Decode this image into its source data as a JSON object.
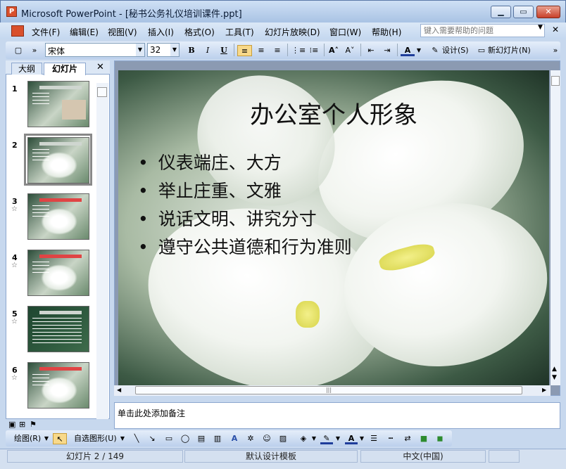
{
  "window": {
    "title": "Microsoft PowerPoint - [秘书公务礼仪培训课件.ppt]"
  },
  "menu": {
    "items": [
      "文件(F)",
      "编辑(E)",
      "视图(V)",
      "插入(I)",
      "格式(O)",
      "工具(T)",
      "幻灯片放映(D)",
      "窗口(W)",
      "帮助(H)"
    ],
    "help_placeholder": "键入需要帮助的问题"
  },
  "toolbar": {
    "font_name": "宋体",
    "font_size": "32",
    "bold": "B",
    "italic": "I",
    "underline": "U",
    "design_label": "设计(S)",
    "new_slide_label": "新幻灯片(N)"
  },
  "panel": {
    "tabs": [
      "大纲",
      "幻灯片"
    ],
    "active_tab": "幻灯片",
    "slides": [
      {
        "num": "1",
        "star": ""
      },
      {
        "num": "2",
        "star": ""
      },
      {
        "num": "3",
        "star": "☆"
      },
      {
        "num": "4",
        "star": "☆"
      },
      {
        "num": "5",
        "star": "☆"
      },
      {
        "num": "6",
        "star": "☆"
      }
    ],
    "selected_slide": 2
  },
  "slide": {
    "title": "办公室个人形象",
    "bullets": [
      "仪表端庄、大方",
      "举止庄重、文雅",
      "说话文明、讲究分寸",
      "遵守公共道德和行为准则"
    ]
  },
  "notes": {
    "placeholder": "单击此处添加备注"
  },
  "drawbar": {
    "draw_label": "绘图(R)",
    "autoshape_label": "自选图形(U)"
  },
  "status": {
    "slide_indicator": "幻灯片 2 / 149",
    "template": "默认设计模板",
    "language": "中文(中国)"
  },
  "colors": {
    "title_bar": "#a9c3e4",
    "office_icon": "#d9502c",
    "accent_close": "#c8402a"
  }
}
